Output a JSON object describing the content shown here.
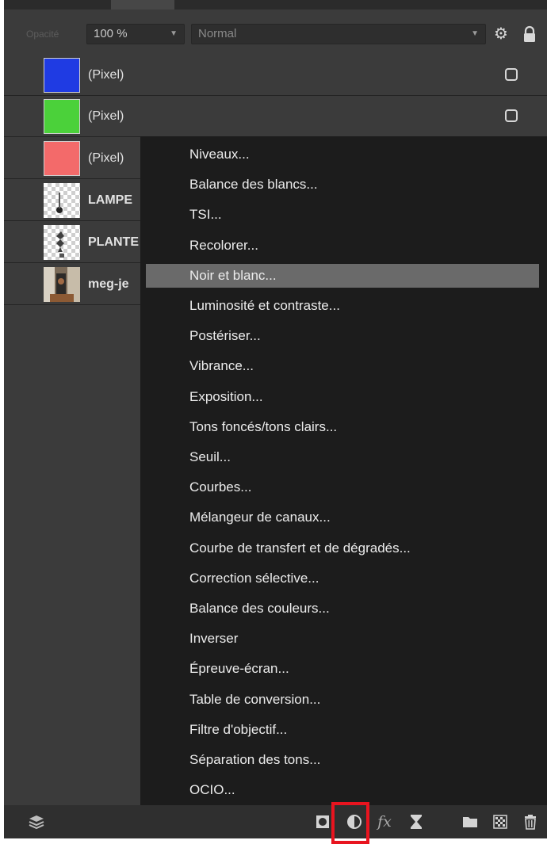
{
  "opacity": {
    "label": "Opacité",
    "value": "100 %"
  },
  "blend_mode": {
    "value": "Normal"
  },
  "icons": {
    "settings": "gear-icon",
    "lock": "lock-icon",
    "layers": "layers-icon",
    "mask": "mask-icon",
    "adjustment": "adjustment-icon",
    "fx": "fx",
    "hourglass": "hourglass-icon",
    "group": "folder-icon",
    "fill": "checker-icon",
    "delete": "trash-icon"
  },
  "layers": [
    {
      "name": "(Pixel)",
      "thumb_color": "#1f3be3"
    },
    {
      "name": "(Pixel)",
      "thumb_color": "#4bd13a"
    },
    {
      "name": "(Pixel)",
      "thumb_color": "#f36a6a"
    },
    {
      "name": "LAMPE"
    },
    {
      "name": "PLANTE"
    },
    {
      "name": "meg-je"
    }
  ],
  "menu": {
    "items": [
      "Niveaux...",
      "Balance des blancs...",
      "TSI...",
      "Recolorer...",
      "Noir et blanc...",
      "Luminosité et contraste...",
      "Postériser...",
      "Vibrance...",
      "Exposition...",
      "Tons foncés/tons clairs...",
      "Seuil...",
      "Courbes...",
      "Mélangeur de canaux...",
      "Courbe de transfert et de dégradés...",
      "Correction sélective...",
      "Balance des couleurs...",
      "Inverser",
      "Épreuve-écran...",
      "Table de conversion...",
      "Filtre d'objectif...",
      "Séparation des tons...",
      "OCIO..."
    ],
    "highlighted_index": 4,
    "highlight_color": "#6a6a6a"
  },
  "toolbar": {
    "fx_label": "fx"
  },
  "highlight_box_color": "#e8141f"
}
